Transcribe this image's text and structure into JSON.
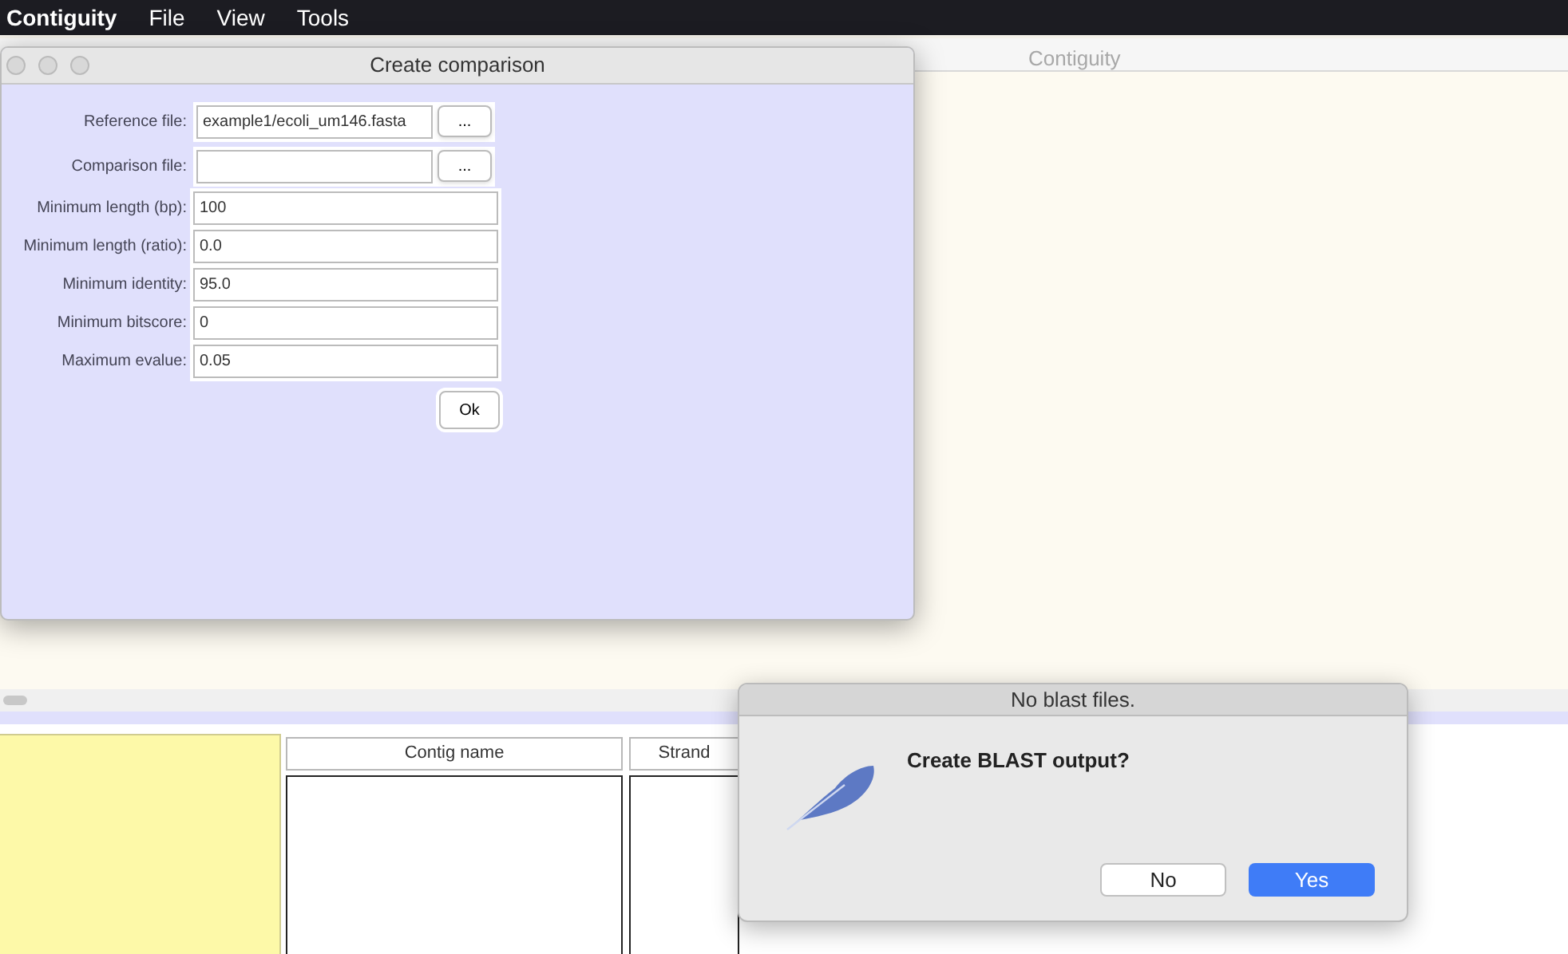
{
  "menu_bar": {
    "app_name": "Contiguity",
    "items": [
      "File",
      "View",
      "Tools"
    ]
  },
  "main_window": {
    "title": "Contiguity",
    "table": {
      "columns": [
        "Contig name",
        "Strand"
      ]
    }
  },
  "comparison_dialog": {
    "title": "Create comparison",
    "file_fields": [
      {
        "label": "Reference file:",
        "value": "example1/ecoli_um146.fasta",
        "button": "..."
      },
      {
        "label": "Comparison file:",
        "button": "..."
      }
    ],
    "fields": [
      {
        "label": "Minimum length (bp):",
        "value": "100"
      },
      {
        "label": "Minimum length (ratio):",
        "value": "0.0"
      },
      {
        "label": "Minimum identity:",
        "value": "95.0"
      },
      {
        "label": "Minimum bitscore:",
        "value": "0"
      },
      {
        "label": "Maximum evalue:",
        "value": "0.05"
      }
    ],
    "ok_button": "Ok"
  },
  "alert": {
    "title": "No blast files.",
    "message": "Create BLAST output?",
    "buttons": [
      {
        "label": "No",
        "default": false
      },
      {
        "label": "Yes",
        "default": true
      }
    ]
  }
}
